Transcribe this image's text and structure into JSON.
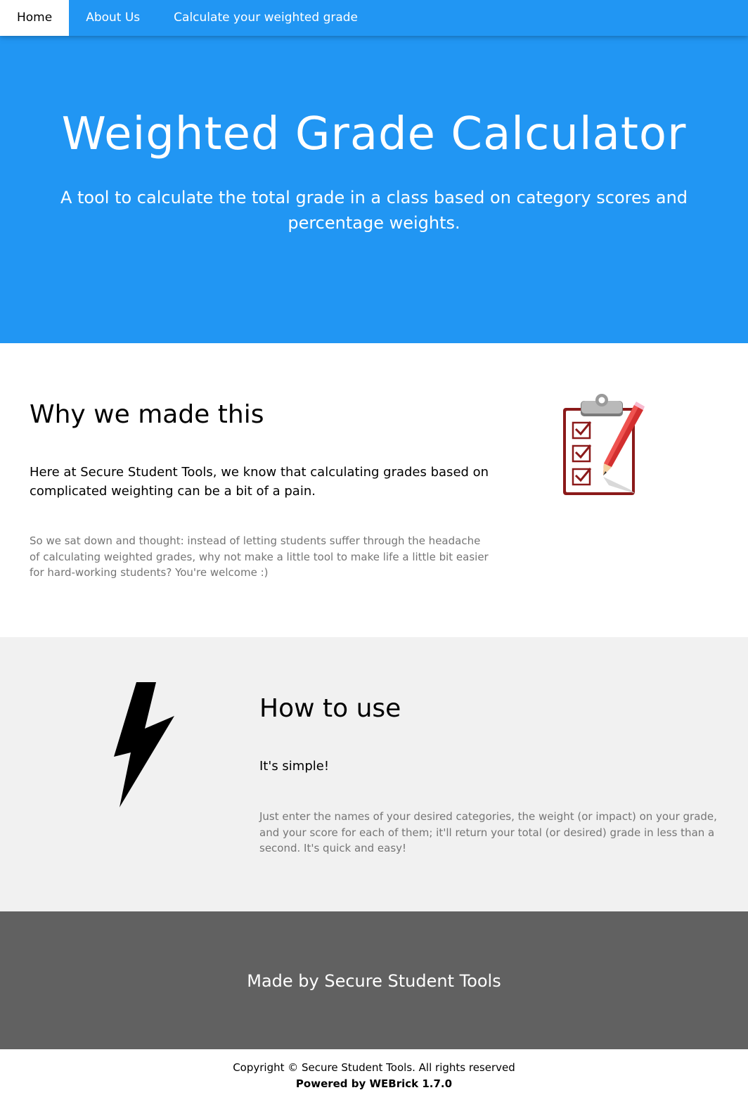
{
  "nav": {
    "items": [
      {
        "label": "Home",
        "active": true
      },
      {
        "label": "About Us",
        "active": false
      },
      {
        "label": "Calculate your weighted grade",
        "active": false
      }
    ]
  },
  "hero": {
    "title": "Weighted Grade Calculator",
    "subtitle": "A tool to calculate the total grade in a class based on category scores and percentage weights."
  },
  "why": {
    "heading": "Why we made this",
    "lead": "Here at Secure Student Tools, we know that calculating grades based on complicated weighting can be a bit of a pain.",
    "body": "So we sat down and thought: instead of letting students suffer through the headache of calculating weighted grades, why not make a little tool to make life a little bit easier for hard-working students? You're welcome :)",
    "image_icon": "clipboard-checklist-pencil-icon"
  },
  "how": {
    "heading": "How to use",
    "lead": "It's simple!",
    "body": "Just enter the names of your desired categories, the weight (or impact) on your grade, and your score for each of them; it'll return your total (or desired) grade in less than a second. It's quick and easy!",
    "image_icon": "lightning-bolt-icon"
  },
  "made_by": {
    "text": "Made by Secure Student Tools"
  },
  "footer": {
    "copyright": "Copyright © Secure Student Tools. All rights reserved",
    "powered": "Powered by WEBrick 1.7.0"
  },
  "colors": {
    "primary": "#2196f3",
    "light_gray": "#f1f1f1",
    "dark_gray": "#616161",
    "muted_text": "#757575"
  }
}
